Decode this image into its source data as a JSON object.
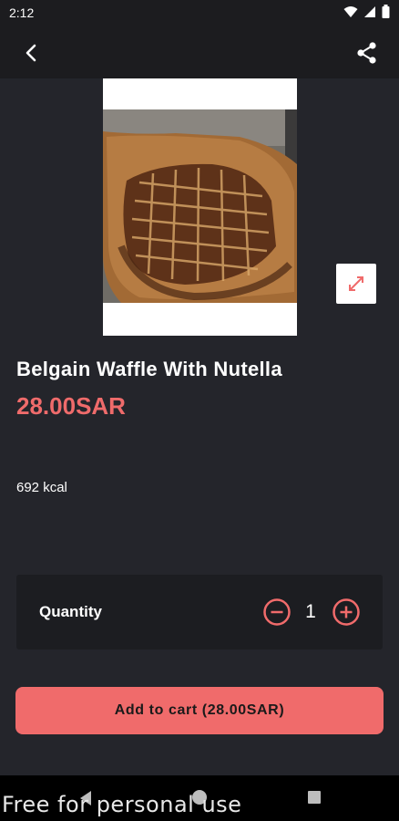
{
  "status_bar": {
    "time": "2:12"
  },
  "product": {
    "name": "Belgain Waffle With Nutella",
    "price": "28.00SAR",
    "calories": "692 kcal"
  },
  "quantity": {
    "label": "Quantity",
    "value": "1"
  },
  "cart": {
    "button_label": "Add to cart (28.00SAR)"
  },
  "watermark": "Free for personal use",
  "colors": {
    "accent": "#f06b6b",
    "background": "#24252b",
    "panel": "#1c1d21",
    "app_bar": "#1c1c1f"
  },
  "icons": {
    "back": "arrow-back-icon",
    "share": "share-icon",
    "expand": "expand-icon",
    "minus": "minus-circle-icon",
    "plus": "plus-circle-icon"
  }
}
